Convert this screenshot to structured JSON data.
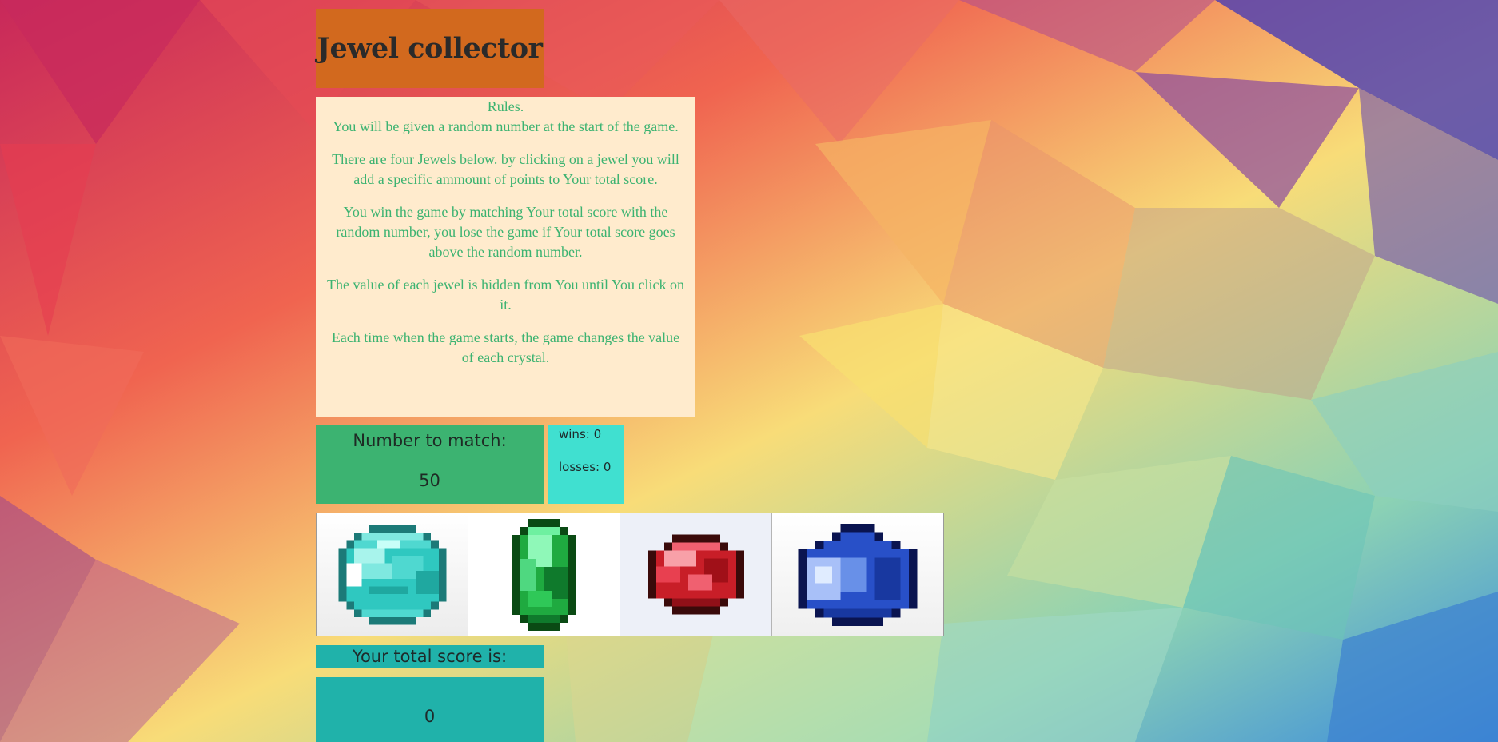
{
  "title": "Jewel collector",
  "rules": {
    "heading": "Rules.",
    "paragraphs": [
      "You will be given a random number at the start of the game.",
      "There are four Jewels below. by clicking on a jewel you will add a specific ammount of points to Your total score.",
      "You win the game by matching Your total score with the random number, you lose the game if Your total score goes above the random number.",
      "The value of each jewel is hidden from You until You click on it.",
      "Each time when the game starts, the game changes the value of each crystal."
    ]
  },
  "match": {
    "label": "Number to match:",
    "value": "50"
  },
  "stats": {
    "wins": "wins: 0",
    "losses": "losses: 0"
  },
  "jewels": [
    {
      "name": "diamond-jewel-icon",
      "color": "#40e0d0"
    },
    {
      "name": "emerald-jewel-icon",
      "color": "#1faa40"
    },
    {
      "name": "ruby-jewel-icon",
      "color": "#c81e28"
    },
    {
      "name": "sapphire-jewel-icon",
      "color": "#2850c8"
    }
  ],
  "score": {
    "label": "Your total score is:",
    "value": "0"
  },
  "colors": {
    "title_bg": "#d2691e",
    "rules_bg": "#ffebcd",
    "rules_text": "#3cb371",
    "match_bg": "#3cb371",
    "stats_bg": "#40e0d0",
    "score_bg": "#20b2aa"
  }
}
